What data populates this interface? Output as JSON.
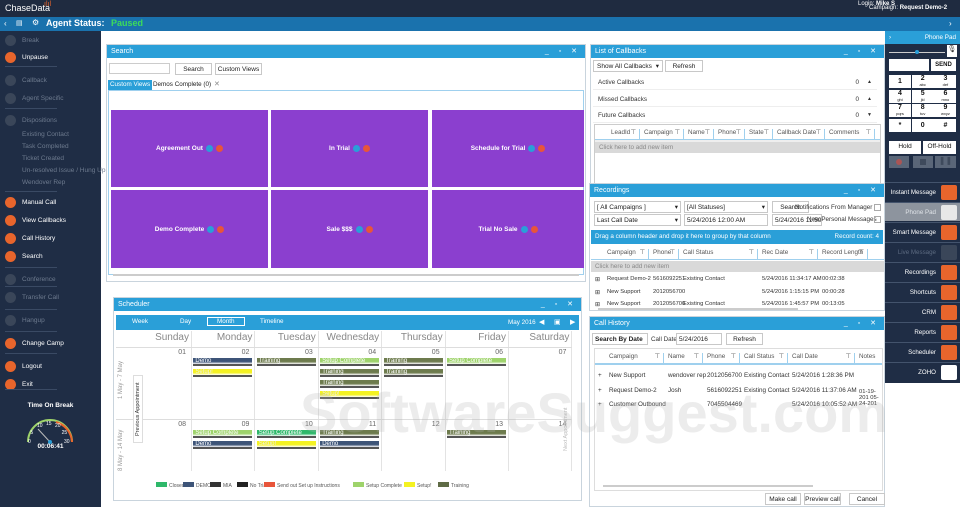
{
  "header": {
    "logo": "ChaseData",
    "status_label": "Agent Status:",
    "status_value": "Paused",
    "login_label": "Login:",
    "login_value": "Mike S",
    "campaign_label": "Campaign:",
    "campaign_value": "Request Demo-2"
  },
  "sidebar": {
    "items": [
      {
        "label": "Break",
        "dim": true
      },
      {
        "label": "Unpause",
        "dim": false,
        "color": "#e8652c"
      },
      {
        "label": "Callback",
        "dim": true
      },
      {
        "label": "Agent Specific",
        "dim": true
      },
      {
        "label": "Dispositions",
        "dim": true
      },
      {
        "label": "Existing Contact",
        "dim": true,
        "sub": true
      },
      {
        "label": "Task Completed",
        "dim": true,
        "sub": true
      },
      {
        "label": "Ticket Created",
        "dim": true,
        "sub": true
      },
      {
        "label": "Un-resolved Issue / Hung Up",
        "dim": true,
        "sub": true
      },
      {
        "label": "Wendover Rep",
        "dim": true,
        "sub": true
      },
      {
        "label": "Manual Call",
        "dim": false,
        "color": "#e8652c"
      },
      {
        "label": "View Callbacks",
        "dim": false,
        "color": "#e8652c"
      },
      {
        "label": "Call History",
        "dim": false,
        "color": "#e8652c"
      },
      {
        "label": "Search",
        "dim": false,
        "color": "#e8652c"
      },
      {
        "label": "Conference",
        "dim": true
      },
      {
        "label": "Transfer Call",
        "dim": true
      },
      {
        "label": "Hangup",
        "dim": true
      },
      {
        "label": "Change Camp",
        "dim": false,
        "color": "#e8652c"
      },
      {
        "label": "Logout",
        "dim": false,
        "color": "#e8652c"
      },
      {
        "label": "Exit",
        "dim": false,
        "color": "#e8652c"
      }
    ],
    "timer_title": "Time On Break",
    "timer_value": "00:06:41",
    "gauge_ticks": [
      "0",
      "5",
      "10",
      "15",
      "20",
      "25",
      "30"
    ]
  },
  "search": {
    "title": "Search",
    "input_value": "",
    "search_btn": "Search",
    "custom_views_btn": "Custom Views",
    "tabs": [
      "Custom Views",
      "Demos Complete (0)"
    ],
    "tiles": [
      "Agreement Out",
      "In Trial",
      "Schedule for Trial",
      "Demo Complete",
      "Sale $$$",
      "Trial No Sale"
    ]
  },
  "scheduler": {
    "title": "Scheduler",
    "views": [
      "Week",
      "Day",
      "Month",
      "Timeline"
    ],
    "active_view": "Month",
    "period": "May 2016",
    "days": [
      "Sunday",
      "Monday",
      "Tuesday",
      "Wednesday",
      "Thursday",
      "Friday",
      "Saturday"
    ],
    "weeks": [
      {
        "label": "1 May - 7 May",
        "dates": [
          "01",
          "02",
          "03",
          "04",
          "05",
          "06",
          "07"
        ]
      },
      {
        "label": "8 May - 14 May",
        "dates": [
          "08",
          "09",
          "10",
          "11",
          "12",
          "13",
          "14"
        ]
      }
    ],
    "prev_appt": "Previous Appointment",
    "next_appt": "Next Appointment",
    "events": [
      {
        "w": 0,
        "d": 1,
        "slot": 0,
        "label": "Demo",
        "color": "#3d5478"
      },
      {
        "w": 0,
        "d": 1,
        "slot": 1,
        "label": "Setup!",
        "color": "#f4f221"
      },
      {
        "w": 0,
        "d": 2,
        "slot": 0,
        "label": "Training",
        "color": "#6d7b4d"
      },
      {
        "w": 0,
        "d": 3,
        "slot": 0,
        "label": "Setup Complete",
        "color": "#9ed36b"
      },
      {
        "w": 0,
        "d": 3,
        "slot": 1,
        "label": "Training",
        "color": "#6d7b4d"
      },
      {
        "w": 0,
        "d": 3,
        "slot": 2,
        "label": "Training",
        "color": "#6d7b4d"
      },
      {
        "w": 0,
        "d": 3,
        "slot": 3,
        "label": "Setup!",
        "color": "#f4f221"
      },
      {
        "w": 0,
        "d": 4,
        "slot": 0,
        "label": "Training",
        "color": "#6d7b4d"
      },
      {
        "w": 0,
        "d": 4,
        "slot": 1,
        "label": "Training",
        "color": "#6d7b4d"
      },
      {
        "w": 0,
        "d": 5,
        "slot": 0,
        "label": "Setup Complete",
        "color": "#9ed36b"
      },
      {
        "w": 1,
        "d": 1,
        "slot": 0,
        "label": "Setup Complete",
        "color": "#9ed36b"
      },
      {
        "w": 1,
        "d": 1,
        "slot": 1,
        "label": "Demo",
        "color": "#3d5478"
      },
      {
        "w": 1,
        "d": 2,
        "slot": 0,
        "label": "Setup Complete",
        "color": "#2eb86a"
      },
      {
        "w": 1,
        "d": 2,
        "slot": 1,
        "label": "Setup!",
        "color": "#f4f221"
      },
      {
        "w": 1,
        "d": 3,
        "slot": 0,
        "label": "Training",
        "color": "#6d7b4d"
      },
      {
        "w": 1,
        "d": 3,
        "slot": 1,
        "label": "Demo",
        "color": "#3d5478"
      },
      {
        "w": 1,
        "d": 5,
        "slot": 0,
        "label": "Training",
        "color": "#6d7b4d"
      }
    ],
    "legend": [
      {
        "label": "Closed",
        "color": "#2eb86a"
      },
      {
        "label": "DEMO",
        "color": "#3d5478"
      },
      {
        "label": "MIA",
        "color": "#333"
      },
      {
        "label": "No Trial",
        "color": "#222"
      },
      {
        "label": "Send out Set up Instructions",
        "color": "#e8553a"
      },
      {
        "label": "Setup Complete",
        "color": "#9ed36b"
      },
      {
        "label": "Setup!",
        "color": "#f4f221"
      },
      {
        "label": "Training",
        "color": "#5f6b45"
      }
    ]
  },
  "callbacks": {
    "title": "List of Callbacks",
    "filter": "Show All Callbacks",
    "refresh": "Refresh",
    "groups": [
      {
        "label": "Active Callbacks",
        "count": "0"
      },
      {
        "label": "Missed Callbacks",
        "count": "0"
      },
      {
        "label": "Future Callbacks",
        "count": "0"
      }
    ],
    "columns": [
      "LeadId",
      "Campaign",
      "Name",
      "Phone",
      "State",
      "Callback Date",
      "Comments"
    ],
    "add_row": "Click here to add new item"
  },
  "recordings": {
    "title": "Recordings",
    "campaign_filter": "[ All Campaigns ]",
    "status_filter": "[All Statuses]",
    "search_btn": "Search",
    "date_type": "Last Call Date",
    "date_from": "5/24/2016 12:00 AM",
    "date_to": "5/24/2016 11:59 PM",
    "notif1": "Notifications From Manager",
    "notif2": "New Personal Messages",
    "group_hint": "Drag a column header and drop it here to group by that column",
    "record_count": "Record count: 4",
    "columns": [
      "Campaign",
      "Phone",
      "Call Status",
      "Rec Date",
      "Record Length"
    ],
    "add_row": "Click here to add new item",
    "rows": [
      [
        "Request Demo-2",
        "5616092251",
        "Existing Contact",
        "5/24/2016 11:34:17 AM",
        "00:02:38"
      ],
      [
        "New Support",
        "2012056700",
        "",
        "5/24/2016 1:15:15 PM",
        "00:00:28"
      ],
      [
        "New Support",
        "2012056700",
        "Existing Contact",
        "5/24/2016 1:45:57 PM",
        "00:13:05"
      ]
    ]
  },
  "call_history": {
    "title": "Call History",
    "search_by": "Search By Date",
    "date_label": "Call Date:",
    "date_value": "5/24/2016",
    "refresh": "Refresh",
    "columns": [
      "Campaign",
      "Name",
      "Phone",
      "Call Status",
      "Call Date",
      "Notes"
    ],
    "rows": [
      [
        "New Support",
        "wendover rep",
        "2012056700",
        "Existing Contact",
        "5/24/2016 1:28:36 PM",
        ""
      ],
      [
        "Request Demo-2",
        "Josh",
        "5616092251",
        "Existing Contact",
        "5/24/2016 11:37:06 AM",
        "01-19-201 05-24-201"
      ],
      [
        "Customer Outbound",
        "",
        "7045504469",
        "",
        "5/24/2016 10:05:52 AM",
        ""
      ]
    ],
    "buttons": [
      "Make call",
      "Preview call",
      "Cancel"
    ]
  },
  "phonepad": {
    "title": "Phone Pad",
    "send": "SEND",
    "keys": [
      [
        "1",
        ""
      ],
      [
        "2",
        "abc"
      ],
      [
        "3",
        "def"
      ],
      [
        "4",
        "ghi"
      ],
      [
        "5",
        "jkl"
      ],
      [
        "6",
        "mno"
      ],
      [
        "7",
        "pqrs"
      ],
      [
        "8",
        "tuv"
      ],
      [
        "9",
        "wxyz"
      ],
      [
        "*",
        ""
      ],
      [
        "0",
        ""
      ],
      [
        "#",
        ""
      ]
    ],
    "hold": "Hold",
    "offhold": "Off-Hold"
  },
  "right_menu": [
    {
      "label": "Instant Message",
      "color": "#e8652c"
    },
    {
      "label": "Phone Pad",
      "color": "#e8652c",
      "active": true
    },
    {
      "label": "Smart Message",
      "color": "#e8652c"
    },
    {
      "label": "Live Message",
      "color": "#555",
      "dim": true
    },
    {
      "label": "Recordings",
      "color": "#e8652c"
    },
    {
      "label": "Shortcuts",
      "color": "#e8652c"
    },
    {
      "label": "CRM",
      "color": "#e8652c"
    },
    {
      "label": "Reports",
      "color": "#e8652c"
    },
    {
      "label": "Scheduler",
      "color": "#e8652c"
    },
    {
      "label": "ZOHO",
      "color": "#ffffff"
    }
  ],
  "watermark": "SoftwareSuggest.com"
}
